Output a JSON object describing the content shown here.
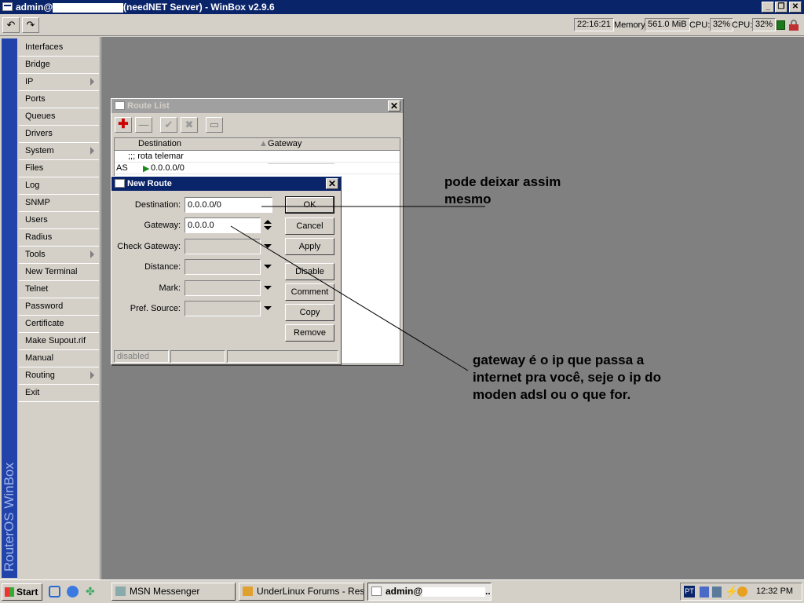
{
  "window": {
    "title_prefix": "admin@",
    "title_suffix": "(needNET Server) - WinBox v2.9.6"
  },
  "toolbar": {
    "undo_label": "↶",
    "redo_label": "↷",
    "time": "22:16:21",
    "memory_label": "Memory:",
    "memory_value": "561.0 MiB",
    "cpu1_label": "CPU:",
    "cpu1_value": "32%",
    "cpu2_label": "CPU:",
    "cpu2_value": "32%"
  },
  "sidebar": {
    "brand": "RouterOS WinBox",
    "items": [
      {
        "label": "Interfaces"
      },
      {
        "label": "Bridge"
      },
      {
        "label": "IP"
      },
      {
        "label": "Ports"
      },
      {
        "label": "Queues"
      },
      {
        "label": "Drivers"
      },
      {
        "label": "System"
      },
      {
        "label": "Files"
      },
      {
        "label": "Log"
      },
      {
        "label": "SNMP"
      },
      {
        "label": "Users"
      },
      {
        "label": "Radius"
      },
      {
        "label": "Tools"
      },
      {
        "label": "New Terminal"
      },
      {
        "label": "Telnet"
      },
      {
        "label": "Password"
      },
      {
        "label": "Certificate"
      },
      {
        "label": "Make Supout.rif"
      },
      {
        "label": "Manual"
      },
      {
        "label": "Routing"
      },
      {
        "label": "Exit"
      }
    ]
  },
  "route_list": {
    "title": "Route List",
    "columns": {
      "destination": "Destination",
      "gateway": "Gateway"
    },
    "rows": [
      {
        "flags": "",
        "destination": ";;; rota telemar",
        "gateway": ""
      },
      {
        "flags": "AS",
        "destination": "0.0.0.0/0",
        "gateway": ""
      }
    ],
    "status": {
      "left": "disabled"
    }
  },
  "new_route": {
    "title": "New Route",
    "labels": {
      "destination": "Destination:",
      "gateway": "Gateway:",
      "check_gateway": "Check Gateway:",
      "distance": "Distance:",
      "mark": "Mark:",
      "pref_source": "Pref. Source:"
    },
    "values": {
      "destination": "0.0.0.0/0",
      "gateway": "0.0.0.0"
    },
    "buttons": {
      "ok": "OK",
      "cancel": "Cancel",
      "apply": "Apply",
      "disable": "Disable",
      "comment": "Comment",
      "copy": "Copy",
      "remove": "Remove"
    },
    "status": {
      "left": "disabled"
    }
  },
  "annotations": {
    "note1_line1": "pode deixar assim",
    "note1_line2": "mesmo",
    "note2_line1": "gateway é o ip que passa  a",
    "note2_line2": "internet pra você, seje o ip do",
    "note2_line3": "moden adsl ou o que for."
  },
  "taskbar": {
    "start_label": "Start",
    "tasks": [
      {
        "label": "MSN Messenger"
      },
      {
        "label": "UnderLinux Forums - Res..."
      },
      {
        "label": "admin@"
      }
    ],
    "lang": "PT",
    "clock": "12:32 PM"
  }
}
